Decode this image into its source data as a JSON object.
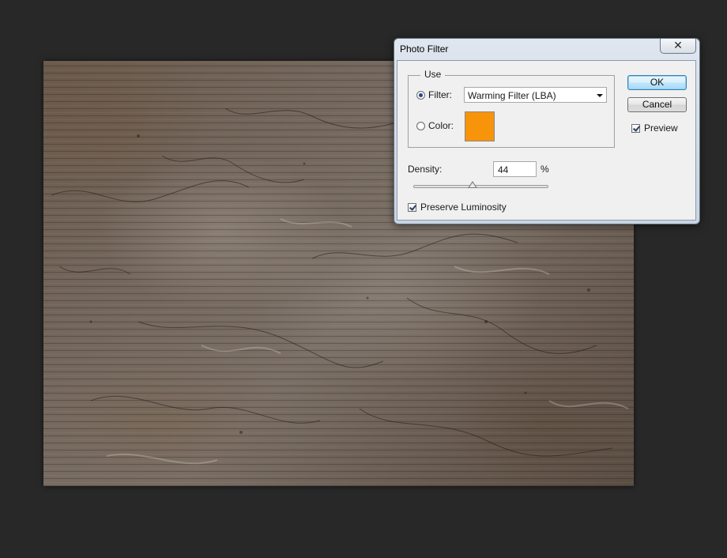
{
  "dialog": {
    "title": "Photo Filter",
    "close_label": "✕"
  },
  "use_group": {
    "title": "Use",
    "filter_label": "Filter:",
    "filter_selected": true,
    "filter_value": "Warming Filter (LBA)",
    "color_label": "Color:",
    "color_selected": false,
    "color_swatch": "#f7940a"
  },
  "density": {
    "label": "Density:",
    "value": "44",
    "unit": "%",
    "slider_percent": 44
  },
  "preserve_luminosity": {
    "label": "Preserve Luminosity",
    "checked": true
  },
  "buttons": {
    "ok_label": "OK",
    "cancel_label": "Cancel"
  },
  "preview": {
    "label": "Preview",
    "checked": true
  },
  "icons": {
    "close": "close-icon",
    "dropdown": "chevron-down-icon"
  }
}
